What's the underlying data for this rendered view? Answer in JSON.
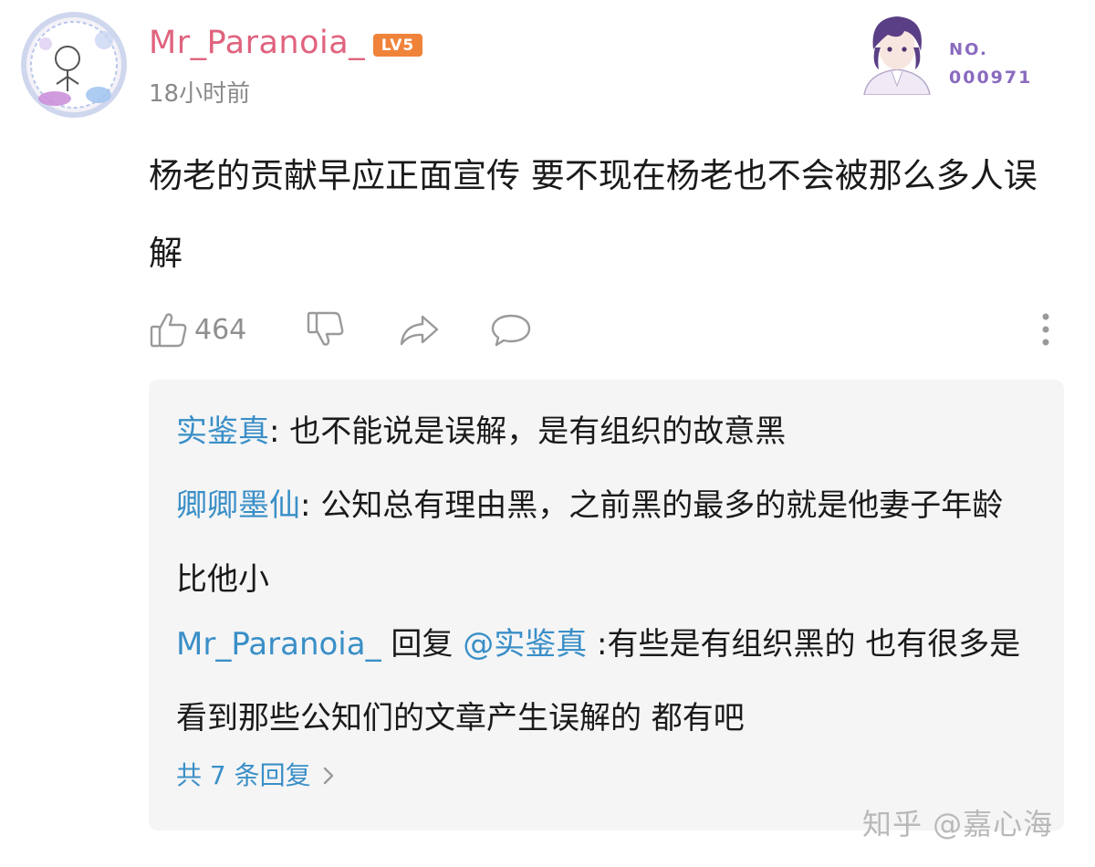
{
  "comment": {
    "username": "Mr_Paranoia_",
    "level": "LV5",
    "timestamp": "18小时前",
    "text": "杨老的贡献早应正面宣传  要不现在杨老也不会被那么多人误解",
    "likes": "464"
  },
  "badge": {
    "no_label": "NO.",
    "number": "000971"
  },
  "replies": [
    {
      "name": "实鉴真",
      "sep": ": ",
      "text": "也不能说是误解，是有组织的故意黑"
    },
    {
      "name": "卿卿墨仙",
      "sep": ": ",
      "text": "公知总有理由黑，之前黑的最多的就是他妻子年龄比他小"
    },
    {
      "name": "Mr_Paranoia_",
      "reply_word": " 回复 ",
      "mention": "@实鉴真",
      "text": " :有些是有组织黑的  也有很多是看到那些公知们的文章产生误解的  都有吧"
    }
  ],
  "more_replies": "共 7 条回复",
  "watermark": "知乎 @嘉心海",
  "colors": {
    "username": "#e0637e",
    "reply_name": "#3a8fc7",
    "level_badge": "#f0833a",
    "badge_text": "#8a6bbf"
  },
  "icons": [
    "thumbs-up-icon",
    "thumbs-down-icon",
    "share-icon",
    "comment-icon",
    "more-vertical-icon",
    "chevron-right-icon"
  ]
}
